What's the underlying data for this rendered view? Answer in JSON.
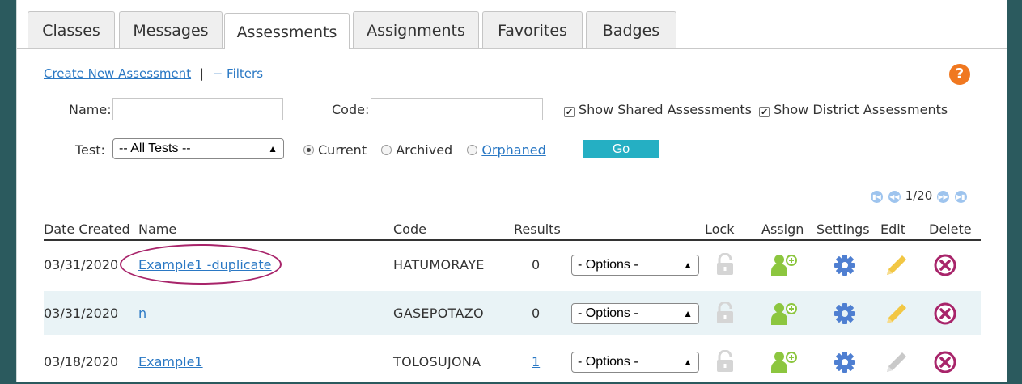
{
  "tabs": [
    "Classes",
    "Messages",
    "Assessments",
    "Assignments",
    "Favorites",
    "Badges"
  ],
  "active_tab": "Assessments",
  "links": {
    "create": "Create New Assessment",
    "separator": "|",
    "filters": "− Filters"
  },
  "filters": {
    "name_label": "Name:",
    "name_value": "",
    "code_label": "Code:",
    "code_value": "",
    "show_shared": "Show Shared Assessments",
    "show_district": "Show District Assessments",
    "test_label": "Test:",
    "test_value": "-- All Tests --",
    "radio_current": "Current",
    "radio_archived": "Archived",
    "radio_orphaned": "Orphaned",
    "go": "Go"
  },
  "pager": {
    "text": "1/20"
  },
  "columns": [
    "Date Created",
    "Name",
    "Code",
    "Results",
    "Lock",
    "Assign",
    "Settings",
    "Edit",
    "Delete"
  ],
  "options_label": "- Options -",
  "rows": [
    {
      "date": "03/31/2020",
      "name": "Example1 -duplicate",
      "code": "HATUMORAYE",
      "results": "0"
    },
    {
      "date": "03/31/2020",
      "name": "n",
      "code": "GASEPOTAZO",
      "results": "0"
    },
    {
      "date": "03/18/2020",
      "name": "Example1",
      "code": "TOLOSUJONA",
      "results": "1"
    }
  ],
  "colors": {
    "assign": "#8cc63f",
    "settings": "#4f7fd1",
    "edit_active": "#f2c744",
    "edit_inactive": "#c9c9c9",
    "delete": "#a8246a",
    "go": "#25afc3",
    "help": "#f07820"
  },
  "icons": [
    "lock-icon",
    "assign-user-icon",
    "gear-icon",
    "pencil-icon",
    "delete-icon",
    "help-icon"
  ]
}
